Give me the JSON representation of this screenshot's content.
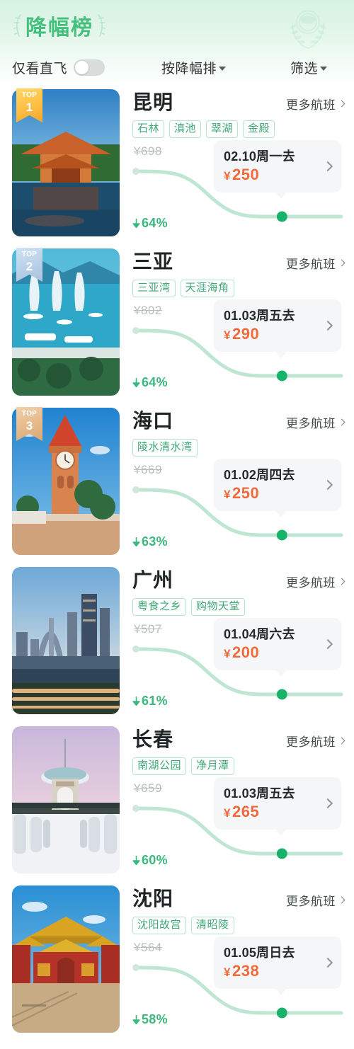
{
  "header": {
    "title": "降幅榜",
    "wreath_icon": "laurel-wreath-icon",
    "accent_color": "#43c07c"
  },
  "controls": {
    "direct_only_label": "仅看直飞",
    "direct_only_on": false,
    "sort_label": "按降幅排",
    "filter_label": "筛选"
  },
  "common": {
    "more_flights_label": "更多航班",
    "yen": "¥",
    "drop_icon": "down-arrow-icon"
  },
  "cards": [
    {
      "rank": "1",
      "rank_tier": "gold",
      "rank_top_text": "TOP",
      "city": "昆明",
      "tags": [
        "石林",
        "滇池",
        "翠湖",
        "金殿"
      ],
      "old_price": "¥698",
      "depart_date": "02.10周一去",
      "price": "250",
      "drop_pct": "64%",
      "image": "kunming-temple-photo"
    },
    {
      "rank": "2",
      "rank_tier": "silver",
      "rank_top_text": "TOP",
      "city": "三亚",
      "tags": [
        "三亚湾",
        "天涯海角"
      ],
      "old_price": "¥802",
      "depart_date": "01.03周五去",
      "price": "290",
      "drop_pct": "64%",
      "image": "sanya-bay-photo"
    },
    {
      "rank": "3",
      "rank_tier": "bronze",
      "rank_top_text": "TOP",
      "city": "海口",
      "tags": [
        "陵水清水湾"
      ],
      "old_price": "¥669",
      "depart_date": "01.02周四去",
      "price": "250",
      "drop_pct": "63%",
      "image": "haikou-clocktower-photo"
    },
    {
      "rank": "",
      "rank_tier": "none",
      "rank_top_text": "",
      "city": "广州",
      "tags": [
        "粤食之乡",
        "购物天堂"
      ],
      "old_price": "¥507",
      "depart_date": "01.04周六去",
      "price": "200",
      "drop_pct": "61%",
      "image": "guangzhou-skyline-photo"
    },
    {
      "rank": "",
      "rank_tier": "none",
      "rank_top_text": "",
      "city": "长春",
      "tags": [
        "南湖公园",
        "净月潭"
      ],
      "old_price": "¥659",
      "depart_date": "01.03周五去",
      "price": "265",
      "drop_pct": "60%",
      "image": "changchun-winter-pavilion-photo"
    },
    {
      "rank": "",
      "rank_tier": "none",
      "rank_top_text": "",
      "city": "沈阳",
      "tags": [
        "沈阳故宫",
        "清昭陵"
      ],
      "old_price": "¥564",
      "depart_date": "01.05周日去",
      "price": "238",
      "drop_pct": "58%",
      "image": "shenyang-palace-photo"
    }
  ]
}
